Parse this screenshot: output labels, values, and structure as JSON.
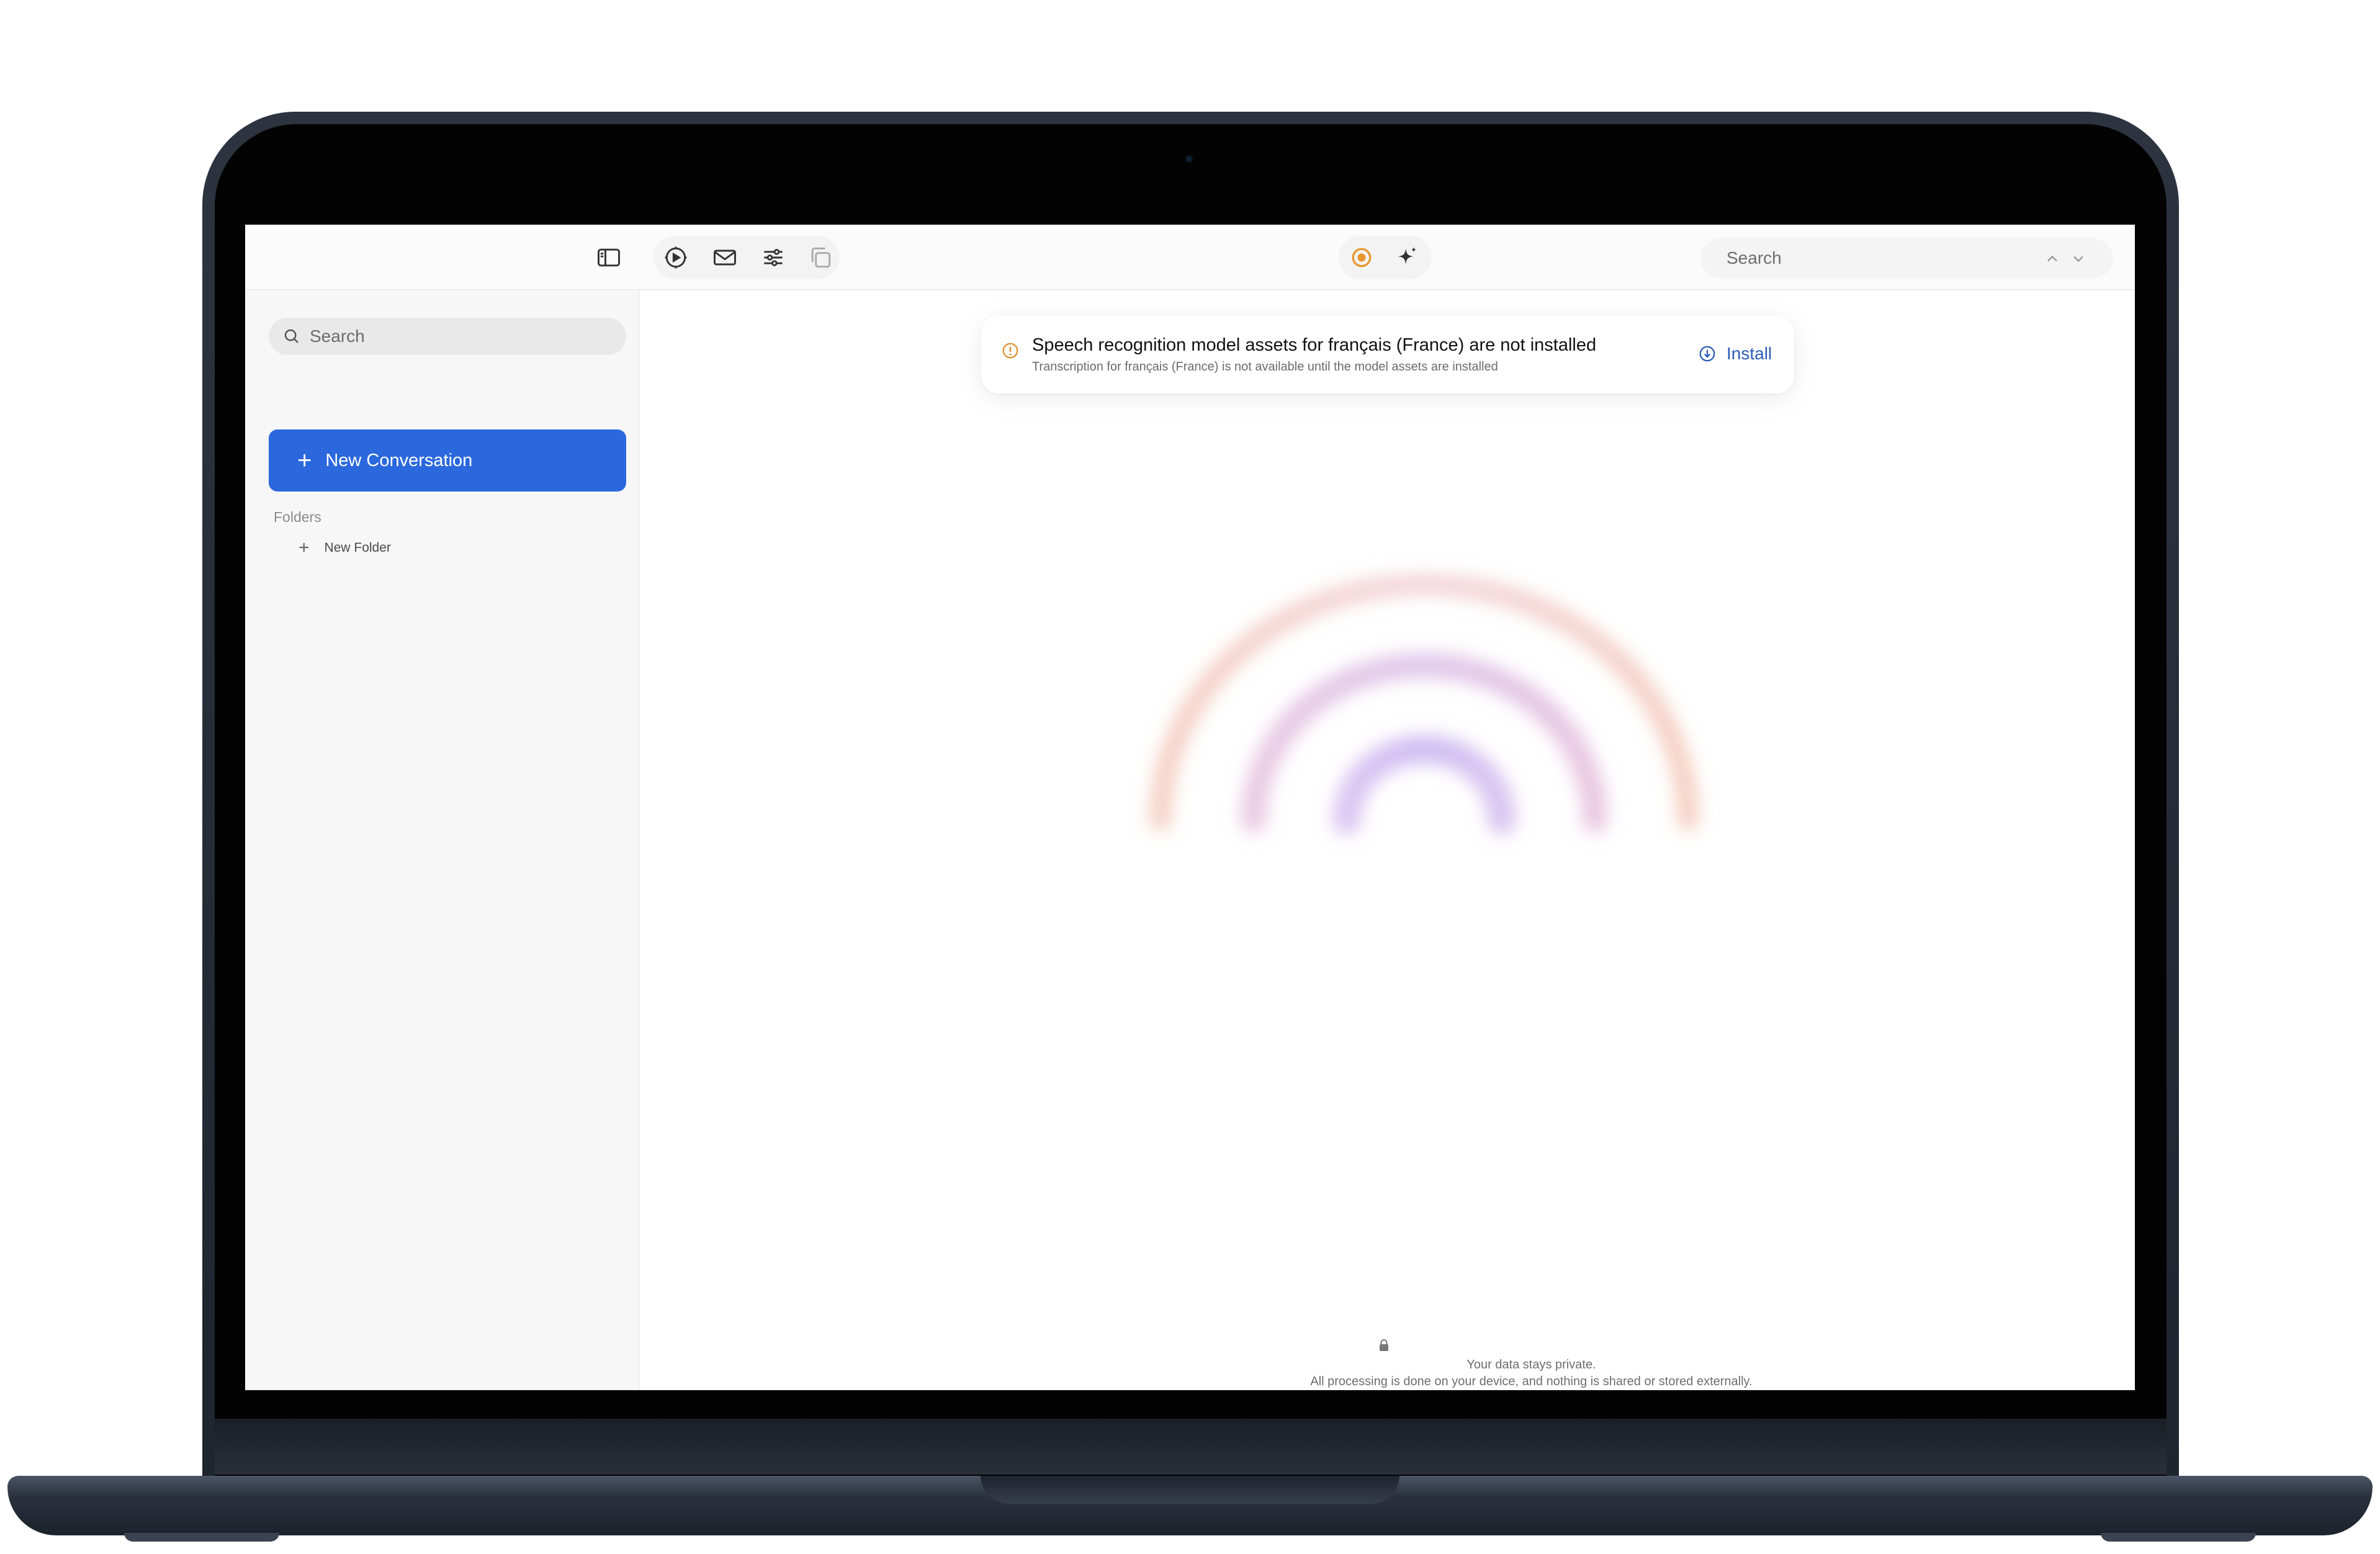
{
  "toolbar": {
    "search_placeholder": "Search"
  },
  "sidebar": {
    "search_placeholder": "Search",
    "new_conversation_label": "New Conversation",
    "folders_label": "Folders",
    "new_folder_label": "New Folder"
  },
  "banner": {
    "title": "Speech recognition model assets for français (France) are not installed",
    "subtitle": "Transcription for français (France) is not available until the model assets are installed",
    "install_label": "Install"
  },
  "footer": {
    "line1": "Your data stays private.",
    "line2": "All processing is done on your device, and nothing is shared or stored externally."
  },
  "colors": {
    "accent": "#2b68de",
    "install": "#2c5bb7",
    "warning": "#e0902c",
    "record": "#e8962f"
  },
  "icons": [
    "sidebar-toggle-icon",
    "clock-play-icon",
    "envelope-icon",
    "sliders-icon",
    "copy-icon",
    "record-icon",
    "sparkle-icon",
    "chevron-up-icon",
    "chevron-down-icon",
    "search-icon",
    "plus-icon",
    "warning-icon",
    "download-icon",
    "lock-icon"
  ]
}
